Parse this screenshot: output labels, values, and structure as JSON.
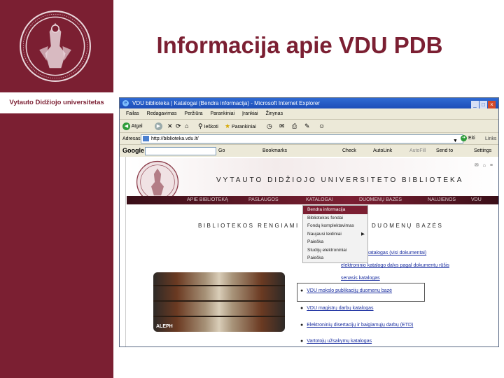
{
  "slide": {
    "title": "Informacija apie VDU PDB",
    "university_name": "Vytauto Didžiojo universitetas"
  },
  "browser": {
    "window_title": "VDU biblioteka | Katalogai (Bendra informacija) - Microsoft Internet Explorer",
    "menu": [
      "Failas",
      "Redagavimas",
      "Peržiūra",
      "Parankiniai",
      "Įrankiai",
      "Žinynas"
    ],
    "toolbar": {
      "back": "Atgal",
      "search": "Ieškoti",
      "favorites": "Parankiniai"
    },
    "address_label": "Adresas",
    "address_value": "http://biblioteka.vdu.lt/",
    "go_label": "Eiti",
    "links_label": "Links",
    "google": {
      "logo": "Google",
      "go": "Go",
      "bookmarks": "Bookmarks",
      "check": "Check",
      "autolink": "AutoLink",
      "autofill": "AutoFill",
      "send_to": "Send to",
      "settings": "Settings"
    }
  },
  "library_page": {
    "banner_title": "VYTAUTO DIDŽIOJO UNIVERSITETO BIBLIOTEKA",
    "nav": [
      "APIE BIBLIOTEKĄ",
      "PASLAUGOS",
      "KATALOGAI",
      "DUOMENŲ BAZĖS",
      "NAUJIENOS",
      "VDU"
    ],
    "dropdown": [
      {
        "label": "Bendra informacija",
        "selected": true
      },
      {
        "label": "Bibliotekos fondai",
        "selected": false
      },
      {
        "label": "Fondų komplektavimas",
        "selected": false
      },
      {
        "label": "Naujausi leidiniai",
        "selected": false
      },
      {
        "label": "Paieška",
        "selected": false
      },
      {
        "label": "Studijų elektroniniai",
        "selected": false
      },
      {
        "label": "Paieška",
        "selected": false
      }
    ],
    "section_left": "BIBLIOTEKOS RENGIAMI",
    "section_right": "DUOMENŲ BAZĖS",
    "photo_label": "ALEPH",
    "items": [
      "elektroninis katalogas (visi dokumentai)",
      "elektroninio katalogo dalys pagal dokumentų rūšis",
      "senasis katalogas",
      "VDU mokslo publikacijų duomenų bazė",
      "VDU magistrų darbų katalogas",
      "Elektroninių disertacijų ir baigiamųjų darbų (ETD)",
      "Vartotojų užsakymų katalogas"
    ]
  }
}
